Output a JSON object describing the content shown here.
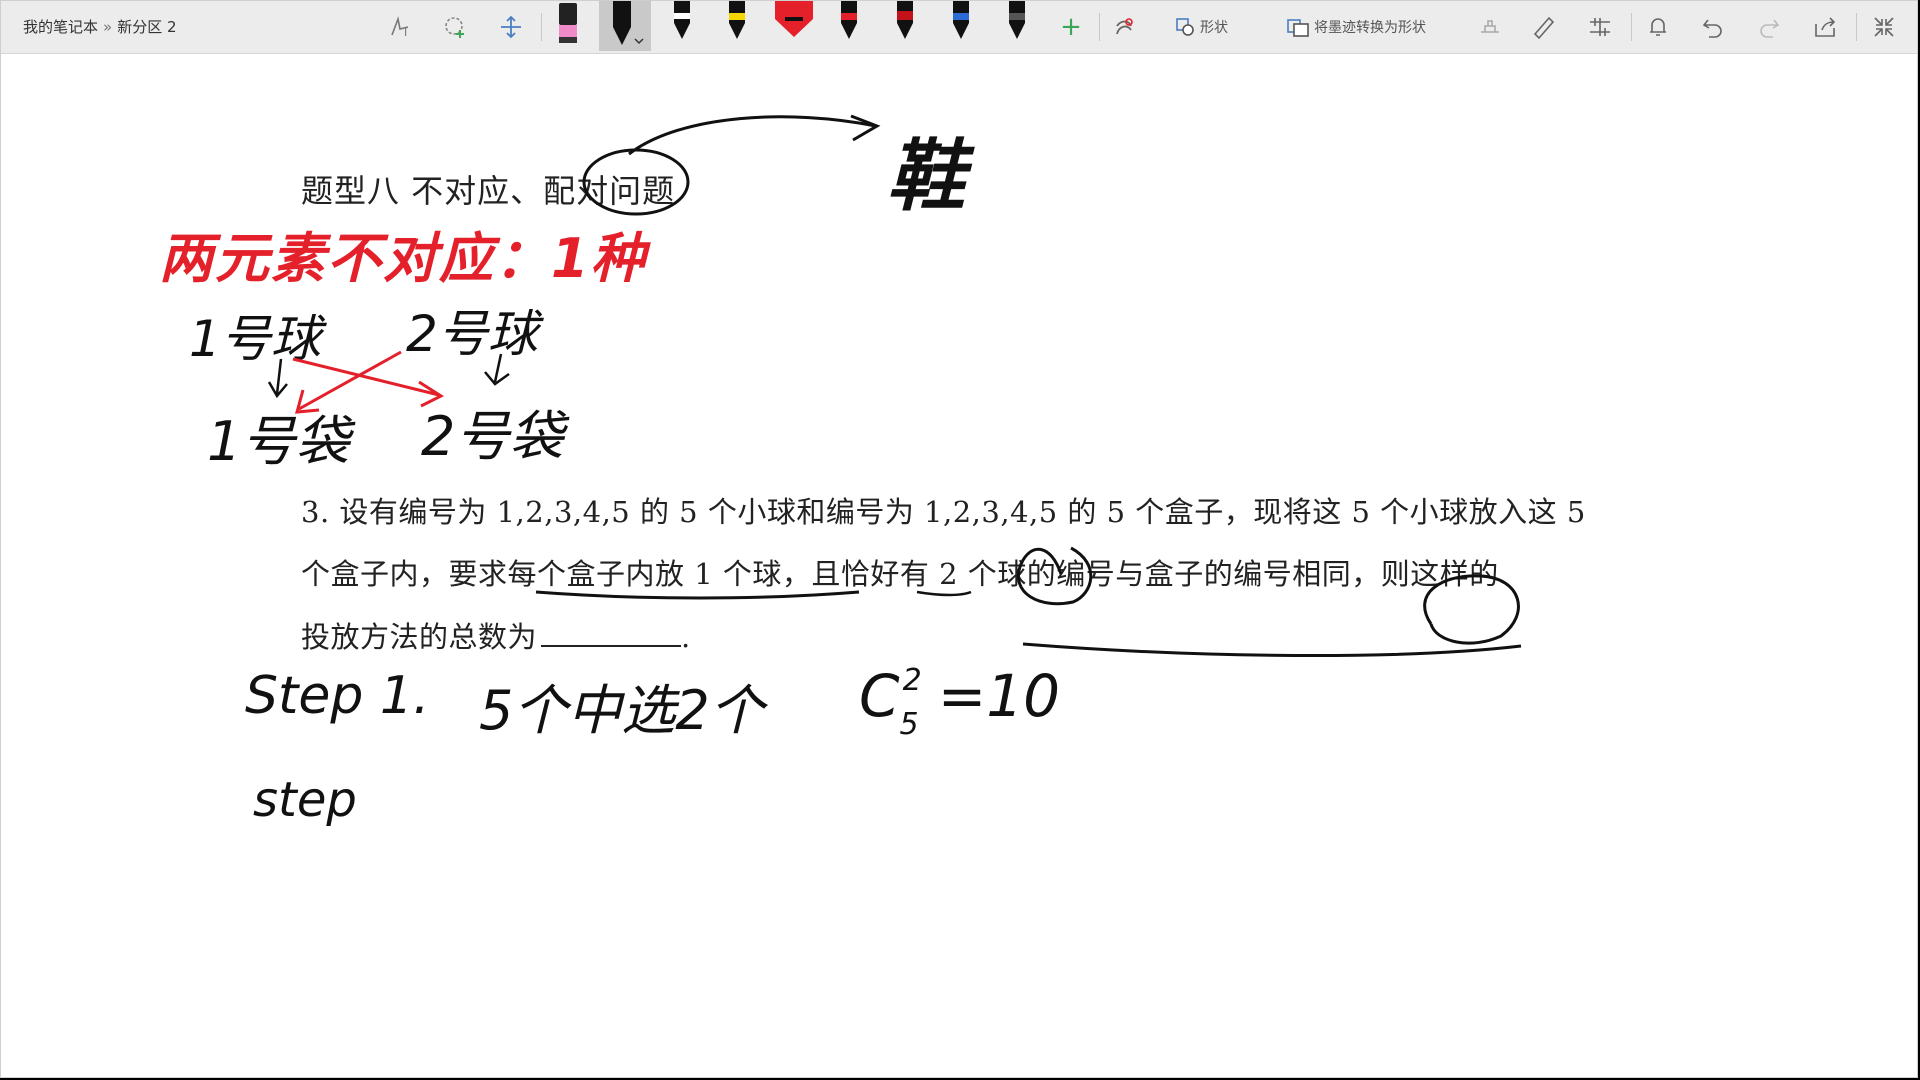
{
  "breadcrumb": {
    "notebook": "我的笔记本",
    "separator": "»",
    "section": "新分区 2"
  },
  "toolbar": {
    "shape_label": "形状",
    "ink_to_shape_label": "将墨迹转换为形状",
    "tools": [
      "lasso-select-icon",
      "eraser-lasso-icon",
      "insert-space-icon",
      "highlighter-pen-icon",
      "ballpoint-pen-icon",
      "add-pen-icon",
      "ink-replay-icon",
      "shape-icon",
      "ink-to-shape-icon",
      "ruler-icon",
      "eraser-icon",
      "align-icon",
      "bell-icon",
      "undo-icon",
      "redo-icon",
      "share-icon",
      "collapse-icon"
    ],
    "pens": [
      {
        "name": "pen-pink-highlighter",
        "color": "#f08ac9"
      },
      {
        "name": "pen-black-selected",
        "color": "#111111"
      },
      {
        "name": "pen-black",
        "color": "#111111"
      },
      {
        "name": "pen-yellow",
        "color": "#f5d800"
      },
      {
        "name": "pen-red-marker",
        "color": "#e4202b"
      },
      {
        "name": "pen-red",
        "color": "#e4202b"
      },
      {
        "name": "pen-dark-red",
        "color": "#c4121b"
      },
      {
        "name": "pen-blue",
        "color": "#2c6bd6"
      },
      {
        "name": "pen-dark",
        "color": "#222222"
      }
    ]
  },
  "document": {
    "title": "题型八  不对应、配对问题",
    "problem_line1": "3. 设有编号为 1,2,3,4,5 的 5 个小球和编号为 1,2,3,4,5 的 5 个盒子，现将这 5 个小球放入这 5",
    "problem_line2": "个盒子内，要求每个盒子内放 1 个球，且恰好有 2 个球的编号与盒子的编号相同，则这样的",
    "problem_line3": "投放方法的总数为",
    "problem_line3_end": "."
  },
  "handwriting": {
    "shoe": "鞋",
    "two_elements_rule": "两元素不对应：1种",
    "ball_1": "1号球",
    "ball_2": "2号球",
    "bag_1": "1号袋",
    "bag_2": "2号袋",
    "step1_label": "Step 1.",
    "step1_text": "5个中选2个",
    "combination": "C",
    "combination_sub": "5",
    "combination_sup": "2",
    "combination_result": "=10",
    "step2_label": "step"
  },
  "ink_colors": {
    "black": "#111111",
    "red": "#e4202b"
  }
}
